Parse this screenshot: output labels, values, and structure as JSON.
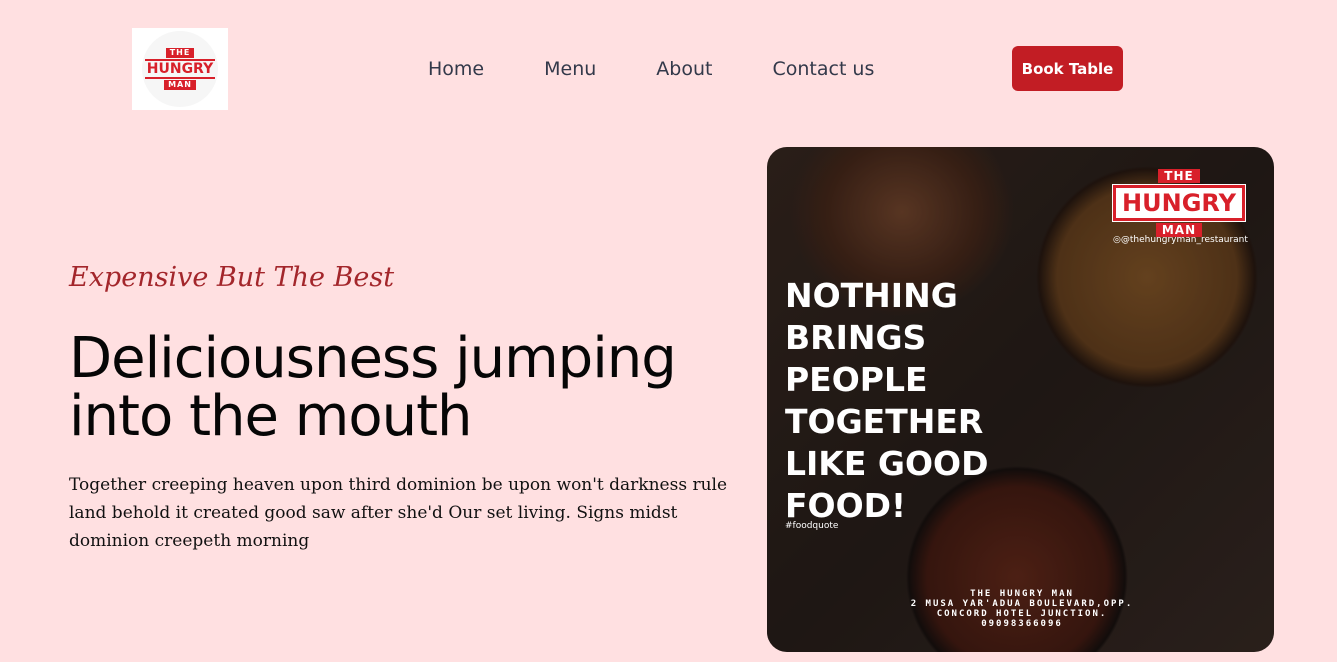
{
  "brand": {
    "logo_top": "THE",
    "logo_main": "HUNGRY",
    "logo_bottom": "MAN"
  },
  "nav": {
    "items": [
      "Home",
      "Menu",
      "About",
      "Contact us"
    ]
  },
  "header": {
    "cta_label": "Book Table"
  },
  "hero": {
    "tagline": "Expensive But The Best",
    "headline": "Deliciousness jumping into the mouth",
    "description": "Together creeping heaven upon third dominion be upon won't darkness rule land behold it created good saw after she'd Our set living. Signs midst dominion creepeth morning"
  },
  "image": {
    "quote_lines": [
      "NOTHING",
      "BRINGS",
      "PEOPLE",
      "TOGETHER",
      "LIKE GOOD",
      "FOOD!"
    ],
    "hashtag": "#foodquote",
    "instagram": "@thehungryman_restaurant",
    "address_lines": [
      "THE HUNGRY MAN",
      "2 MUSA YAR'ADUA BOULEVARD,OPP.",
      "CONCORD HOTEL JUNCTION.",
      "09098366096"
    ]
  },
  "colors": {
    "background": "#ffe0e1",
    "accent": "#c21d24",
    "tagline": "#a3262b",
    "nav_text": "#33394a"
  }
}
